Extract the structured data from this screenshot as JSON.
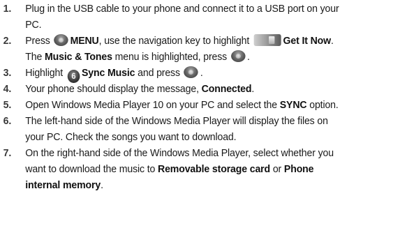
{
  "steps": [
    {
      "number": "1.",
      "lines": [
        "Plug in the USB cable to your phone and connect it to a USB port on your",
        "PC."
      ]
    },
    {
      "number": "2.",
      "press": "Press",
      "menu": "MENU",
      "nav_text": ", use the navigation key to highlight",
      "get_it_now": "Get It Now",
      "period": ".",
      "the": "The",
      "music_tones": "Music & Tones",
      "menu_highlighted": "menu is highlighted, press",
      "end_period": "."
    },
    {
      "number": "3.",
      "highlight": "Highlight",
      "icon_digit": "6",
      "sync_music": "Sync Music",
      "and_press": "and press",
      "end_period": "."
    },
    {
      "number": "4.",
      "text": "Your phone should display the message,",
      "connected": "Connected",
      "end_period": "."
    },
    {
      "number": "5.",
      "text": "Open Windows Media Player 10 on your PC and select the",
      "sync": "SYNC",
      "option": "option."
    },
    {
      "number": "6.",
      "lines": [
        "The left-hand side of the Windows Media Player will display the files on",
        "your PC. Check the songs you want to download."
      ]
    },
    {
      "number": "7.",
      "line1": "On the right-hand side of the Windows Media Player, select whether you",
      "line2_pre": "want to download the music to",
      "removable": "Removable storage card",
      "or": "or",
      "phone": "Phone",
      "internal": "internal memory",
      "end_period": "."
    }
  ],
  "icons": {
    "menu_key": "menu-ok-key-icon",
    "get_it_now": "get-it-now-icon",
    "sync_music_number": "number-6-icon"
  }
}
